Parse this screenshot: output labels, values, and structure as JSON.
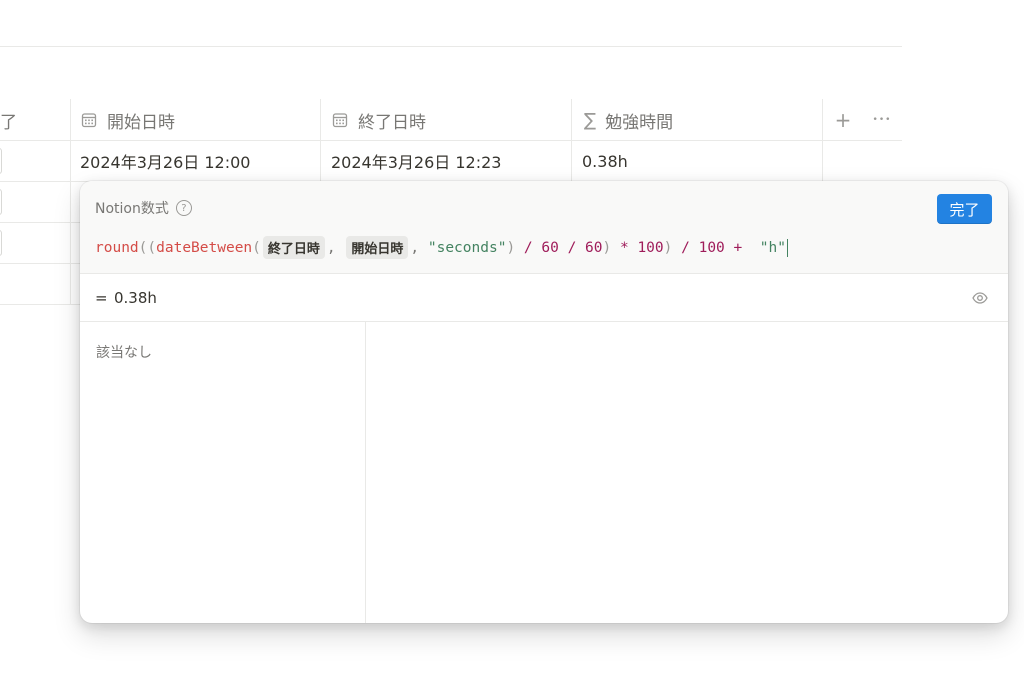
{
  "table": {
    "columns": [
      {
        "label": "了",
        "icon": "none"
      },
      {
        "label": "開始日時",
        "icon": "calendar-icon"
      },
      {
        "label": "終了日時",
        "icon": "calendar-icon"
      },
      {
        "label": "勉強時間",
        "icon": "sigma-icon"
      }
    ],
    "add_label": "+",
    "more_label": "•••",
    "rows": [
      {
        "start": "2024年3月26日 12:00",
        "end": "2024年3月26日 12:23",
        "study": "0.38h"
      }
    ]
  },
  "popup": {
    "title": "Notion数式",
    "help_label": "?",
    "done_label": "完了",
    "formula": {
      "fn1": "round",
      "p1": "((",
      "fn2": "dateBetween",
      "p2": "(",
      "chip1": "終了日時",
      "comma1": ",",
      "chip2": "開始日時",
      "comma2": ",",
      "str1": "\"seconds\"",
      "p3": ")",
      "op1": "/",
      "num1": "60",
      "op2": "/",
      "num2": "60",
      "p4": ")",
      "op3": "*",
      "num3": "100",
      "p5": ")",
      "op4": "/",
      "num4": "100",
      "op5": "+",
      "str2": "\"h\""
    },
    "result_eq": "=",
    "result_value": "0.38h",
    "empty_text": "該当なし"
  }
}
